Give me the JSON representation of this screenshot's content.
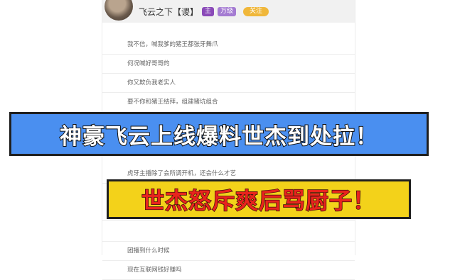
{
  "header": {
    "username": "飞云之下【谡】",
    "icon_badge": "主",
    "level_badge": "万级",
    "follow_label": "关注"
  },
  "messages": [
    "我不信，喊我爹的猪王都张牙舞爪",
    "何况喊好哥哥的",
    "你又欺负我老实人",
    "要不你和猪王结拜，组建猪坑组合"
  ],
  "messages_lower": [
    "",
    "虎牙主播除了会所调开机，还会什么才艺",
    "",
    "",
    "团播到什么时候",
    "现在互联网钱好赚吗"
  ],
  "overlay": {
    "headline": "神豪飞云上线爆料世杰到处拉！",
    "subheadline": "世杰怒斥爽后骂厨子！",
    "headline_bg": "#4a8ff0",
    "subheadline_bg": "#f3d21a",
    "subheadline_color": "#e8241d"
  }
}
